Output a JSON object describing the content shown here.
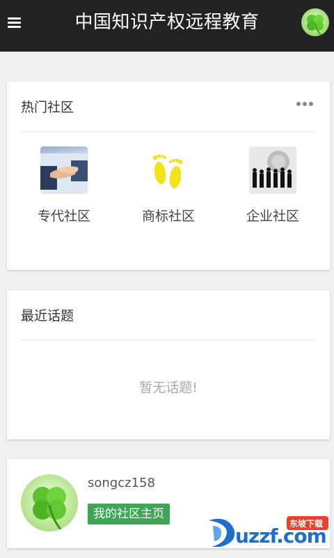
{
  "header": {
    "title": "中国知识产权远程教育",
    "menu_icon": "hamburger-menu-icon",
    "avatar_icon": "clover-avatar-icon"
  },
  "hot_communities": {
    "title": "热门社区",
    "more_icon": "more-dots-icon",
    "items": [
      {
        "label": "专代社区",
        "icon": "handshake-icon"
      },
      {
        "label": "商标社区",
        "icon": "footprints-icon"
      },
      {
        "label": "企业社区",
        "icon": "business-people-icon"
      }
    ]
  },
  "recent_topics": {
    "title": "最近话题",
    "empty_text": "暂无话题!"
  },
  "profile": {
    "username": "songcz158",
    "home_button": "我的社区主页",
    "avatar_icon": "clover-avatar-icon"
  },
  "watermark": {
    "brand": "uzzf.com",
    "tag": "东坡下载"
  },
  "colors": {
    "topbar": "#222222",
    "background": "#f0f0f0",
    "accent_green": "#3fa657",
    "watermark_blue": "#1a6fd1",
    "watermark_red": "#e8412c"
  }
}
